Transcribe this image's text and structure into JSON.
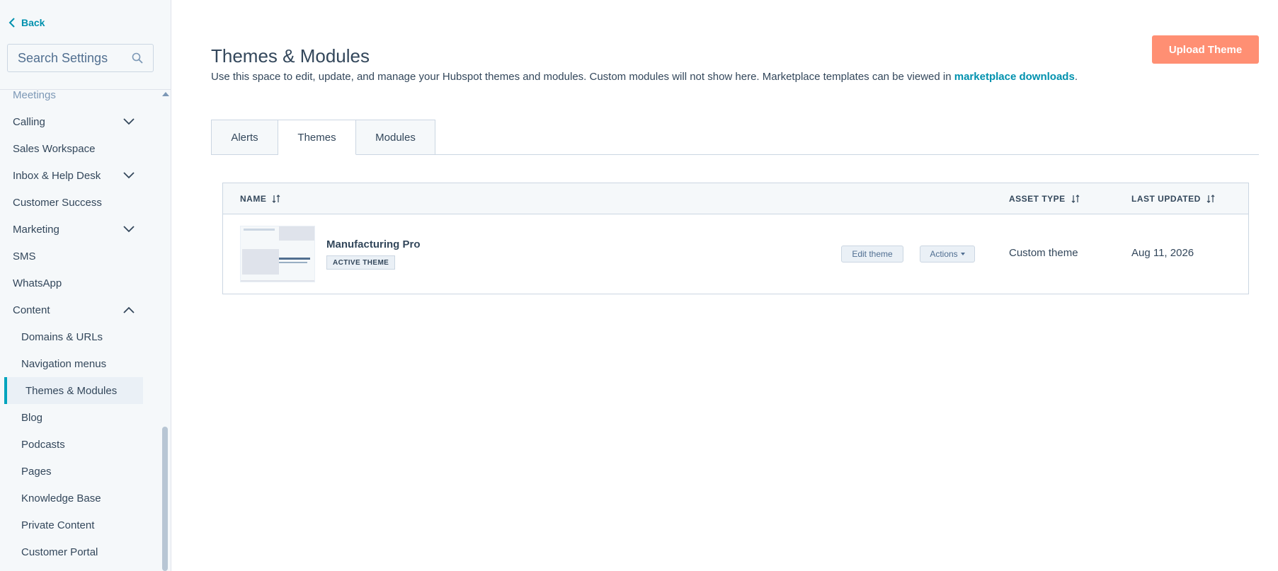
{
  "sidebar": {
    "back_label": "Back",
    "search_placeholder": "Search Settings",
    "items": [
      {
        "label": "Meetings",
        "expandable": false
      },
      {
        "label": "Calling",
        "expandable": true
      },
      {
        "label": "Sales Workspace",
        "expandable": false
      },
      {
        "label": "Inbox & Help Desk",
        "expandable": true
      },
      {
        "label": "Customer Success",
        "expandable": false
      },
      {
        "label": "Marketing",
        "expandable": true
      },
      {
        "label": "SMS",
        "expandable": false
      },
      {
        "label": "WhatsApp",
        "expandable": false
      },
      {
        "label": "Content",
        "expandable": true,
        "expanded": true
      }
    ],
    "sub_items": [
      {
        "label": "Domains & URLs"
      },
      {
        "label": "Navigation menus"
      },
      {
        "label": "Themes & Modules",
        "active": true
      },
      {
        "label": "Blog"
      },
      {
        "label": "Podcasts"
      },
      {
        "label": "Pages"
      },
      {
        "label": "Knowledge Base"
      },
      {
        "label": "Private Content"
      },
      {
        "label": "Customer Portal"
      }
    ]
  },
  "header": {
    "title": "Themes & Modules",
    "subtitle_text": "Use this space to edit, update, and manage your Hubspot themes and modules. Custom modules will not show here. Marketplace templates can be viewed in ",
    "subtitle_link": "marketplace downloads",
    "subtitle_end": ".",
    "upload_button": "Upload Theme"
  },
  "tabs": [
    {
      "label": "Alerts"
    },
    {
      "label": "Themes",
      "selected": true
    },
    {
      "label": "Modules"
    }
  ],
  "table": {
    "columns": {
      "name": "NAME",
      "asset_type": "ASSET TYPE",
      "last_updated": "LAST UPDATED"
    },
    "rows": [
      {
        "name": "Manufacturing Pro",
        "badge": "ACTIVE THEME",
        "edit_label": "Edit theme",
        "actions_label": "Actions",
        "asset_type": "Custom theme",
        "last_updated": "Aug 11, 2026"
      }
    ]
  },
  "colors": {
    "accent": "#0091ae",
    "primary_button": "#ff8f73",
    "active_indicator": "#00a4bd",
    "text": "#33475b"
  }
}
